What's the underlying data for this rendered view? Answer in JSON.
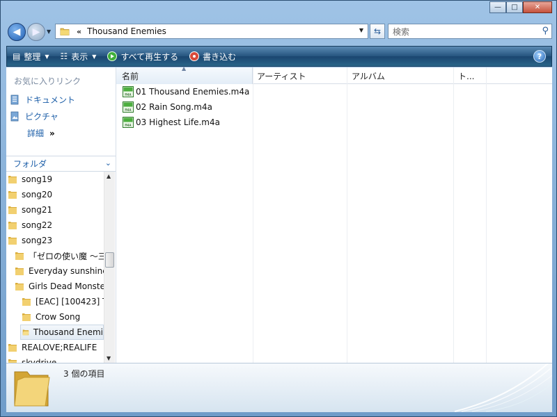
{
  "window": {
    "minimize_label": "—",
    "maximize_label": "□",
    "close_label": "✕"
  },
  "nav": {
    "path_prefix": "«",
    "path": "Thousand Enemies",
    "search_placeholder": "検索"
  },
  "toolbar": {
    "organize": "整理",
    "views": "表示",
    "play_all": "すべて再生する",
    "burn": "書き込む",
    "help": "?"
  },
  "sidebar": {
    "favorites_title": "お気に入りリンク",
    "favorites": [
      {
        "label": "ドキュメント"
      },
      {
        "label": "ピクチャ"
      }
    ],
    "more_label": "詳細",
    "more_chevron": "»",
    "folders_title": "フォルダ",
    "tree": [
      {
        "label": "song19",
        "level": 0
      },
      {
        "label": "song20",
        "level": 0
      },
      {
        "label": "song21",
        "level": 0
      },
      {
        "label": "song22",
        "level": 0
      },
      {
        "label": "song23",
        "level": 0
      },
      {
        "label": "「ゼロの使い魔 ～三",
        "level": 1
      },
      {
        "label": "Everyday sunshine",
        "level": 1
      },
      {
        "label": "Girls Dead Monste",
        "level": 1
      },
      {
        "label": "[EAC] [100423] T",
        "level": 2
      },
      {
        "label": "Crow Song",
        "level": 2
      },
      {
        "label": "Thousand Enemi",
        "level": 2,
        "selected": true
      },
      {
        "label": "REALOVE;REALIFE",
        "level": 1
      },
      {
        "label": "skydrive",
        "level": 1
      }
    ]
  },
  "columns": [
    {
      "label": "名前"
    },
    {
      "label": "アーティスト"
    },
    {
      "label": "アルバム"
    },
    {
      "label": "ト..."
    }
  ],
  "files": [
    {
      "name": "01 Thousand Enemies.m4a"
    },
    {
      "name": "02 Rain Song.m4a"
    },
    {
      "name": "03 Highest Life.m4a"
    }
  ],
  "status": {
    "count_text": "3 個の項目"
  },
  "colors": {
    "link_blue": "#1c5ea8",
    "toolbar_dark": "#1a4670"
  }
}
